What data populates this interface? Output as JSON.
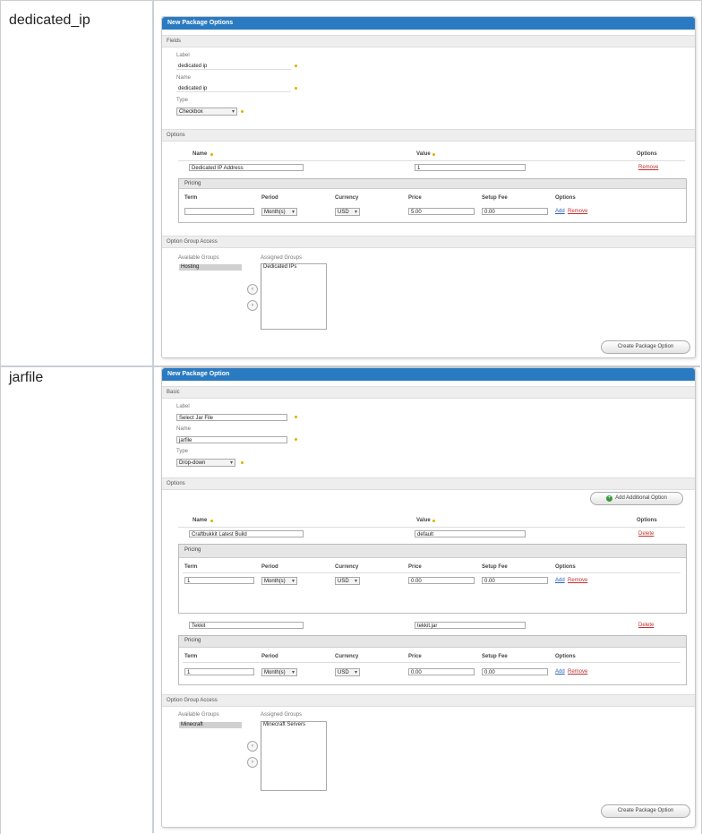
{
  "rows": [
    {
      "label": "dedicated_ip",
      "panel": {
        "title": "New Package Options",
        "fields_section": "Fields",
        "label_label": "Label",
        "label_value": "dedicated ip",
        "name_label": "Name",
        "name_value": "dedicated ip",
        "type_label": "Type",
        "type_value": "Checkbox",
        "options_section": "Options",
        "col_name": "Name",
        "col_value": "Value",
        "col_options": "Options",
        "option_name_value": "Dedicated IP Address",
        "option_value_value": "1",
        "option_remove": "Remove",
        "pricing_title": "Pricing",
        "pricing_cols": [
          "Term",
          "Period",
          "Currency",
          "Price",
          "Setup Fee",
          "Options"
        ],
        "pricing_period": "Month(s)",
        "pricing_currency": "USD",
        "pricing_price": "5.00",
        "pricing_setup": "0.00",
        "pricing_add": "Add",
        "pricing_remove": "Remove",
        "groups_section": "Option Group Access",
        "available_label": "Available Groups",
        "assigned_label": "Assigned Groups",
        "available_item": "Hosting",
        "assigned_item": "Dedicated IPs",
        "move_left": "‹",
        "move_right": "›",
        "submit": "Create Package Option"
      }
    },
    {
      "label": "jarfile",
      "panel": {
        "title": "New Package Option",
        "fields_section": "Basic",
        "label_label": "Label",
        "label_value": "Select Jar File",
        "name_label": "Name",
        "name_value": "jarfile",
        "type_label": "Type",
        "type_value": "Drop-down",
        "options_section": "Options",
        "add_option_btn": "Add Additional Option",
        "col_name": "Name",
        "col_value": "Value",
        "col_options": "Options",
        "option1_name": "Craftbukkit Latest Build",
        "option1_value": "default",
        "option1_remove": "Delete",
        "pricing_title": "Pricing",
        "pricing_cols": [
          "Term",
          "Period",
          "Currency",
          "Price",
          "Setup Fee",
          "Options"
        ],
        "pricing1_term": "1",
        "pricing1_period": "Month(s)",
        "pricing1_currency": "USD",
        "pricing1_price": "0.00",
        "pricing1_setup": "0.00",
        "pricing_add": "Add",
        "pricing_remove": "Remove",
        "option2_name": "Tekkit",
        "option2_value": "tekkit.jar",
        "option2_remove": "Delete",
        "pricing2_term": "1",
        "pricing2_period": "Month(s)",
        "pricing2_currency": "USD",
        "pricing2_price": "0.00",
        "pricing2_setup": "0.00",
        "groups_section": "Option Group Access",
        "available_label": "Available Groups",
        "assigned_label": "Assigned Groups",
        "available_item": "Minecraft",
        "assigned_item": "Minecraft Servers",
        "move_left": "‹",
        "move_right": "›",
        "submit": "Create Package Option"
      }
    }
  ]
}
